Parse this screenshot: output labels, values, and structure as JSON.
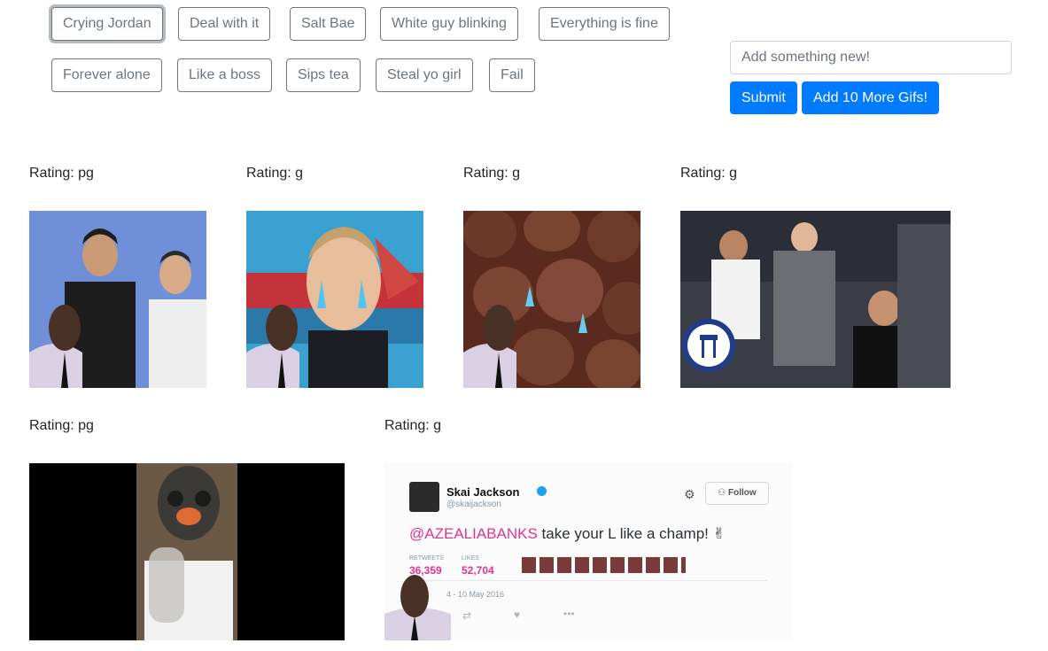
{
  "topics": [
    {
      "label": "Crying Jordan"
    },
    {
      "label": "Deal with it"
    },
    {
      "label": "Salt Bae"
    },
    {
      "label": "White guy blinking"
    },
    {
      "label": "Everything is fine"
    },
    {
      "label": "Forever alone"
    },
    {
      "label": "Like a boss"
    },
    {
      "label": "Sips tea"
    },
    {
      "label": "Steal yo girl"
    },
    {
      "label": "Fail"
    }
  ],
  "form": {
    "placeholder": "Add something new!",
    "submit_label": "Submit",
    "more_label": "Add 10 More Gifs!"
  },
  "gifs": [
    {
      "rating": "Rating: pg"
    },
    {
      "rating": "Rating: g"
    },
    {
      "rating": "Rating: g"
    },
    {
      "rating": "Rating: g"
    },
    {
      "rating": "Rating: pg"
    },
    {
      "rating": "Rating: g"
    }
  ],
  "tweet": {
    "name": "Skai Jackson",
    "handle": "@skaijackson",
    "follow": "Follow",
    "mention": "@AZEALIABANKS",
    "body": " take your L like a champ!",
    "retweets_label": "RETWEETS",
    "retweets": "36,359",
    "likes_label": "LIKES",
    "likes": "52,704",
    "date": "4 - 10 May 2016"
  },
  "colors": {
    "primary": "#007bff",
    "secondary": "#6c757d",
    "tweet_pink": "#e0358f"
  }
}
